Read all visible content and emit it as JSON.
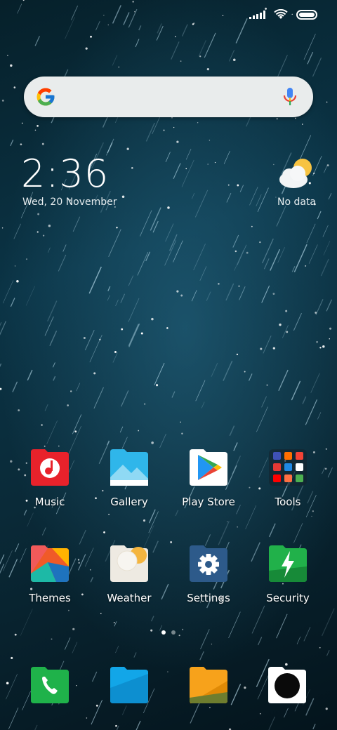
{
  "status_bar": {
    "signal_icon": "cellular-signal-icon",
    "wifi_icon": "wifi-icon",
    "battery_icon": "battery-icon"
  },
  "search": {
    "logo_icon": "google-g-icon",
    "mic_icon": "microphone-icon"
  },
  "clock_widget": {
    "time": "2:36",
    "date": "Wed, 20 November"
  },
  "weather_widget": {
    "icon": "partly-cloudy-icon",
    "label": "No data"
  },
  "apps": [
    {
      "label": "Music",
      "icon": "music-icon",
      "color": "#e8222b"
    },
    {
      "label": "Gallery",
      "icon": "gallery-icon",
      "color": "#2fb6ea"
    },
    {
      "label": "Play Store",
      "icon": "play-store-icon",
      "color": "#ffffff"
    },
    {
      "label": "Tools",
      "icon": "tools-folder-icon",
      "color": "#1b2a33"
    },
    {
      "label": "Themes",
      "icon": "themes-icon",
      "color": "#f05a28"
    },
    {
      "label": "Weather",
      "icon": "weather-icon",
      "color": "#f4b53f"
    },
    {
      "label": "Settings",
      "icon": "settings-gear-icon",
      "color": "#2d5a8a"
    },
    {
      "label": "Security",
      "icon": "security-shield-icon",
      "color": "#21b14a"
    }
  ],
  "page_indicator": {
    "pages": 2,
    "current": 1
  },
  "dock": [
    {
      "icon": "phone-icon",
      "color": "#1fb24a"
    },
    {
      "icon": "messages-icon",
      "color": "#12a6e8"
    },
    {
      "icon": "file-manager-icon",
      "color": "#f7a21b"
    },
    {
      "icon": "camera-icon",
      "color": "#ffffff"
    }
  ]
}
